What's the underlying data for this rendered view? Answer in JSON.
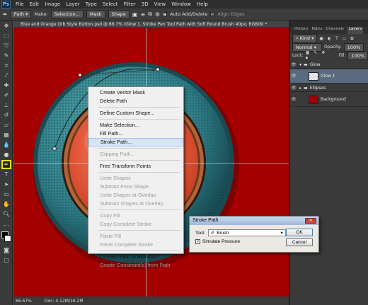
{
  "app": {
    "logo": "Ps"
  },
  "menubar": {
    "items": [
      "File",
      "Edit",
      "Image",
      "Layer",
      "Type",
      "Select",
      "Filter",
      "3D",
      "View",
      "Window",
      "Help"
    ]
  },
  "options": {
    "mode": "Path",
    "make_label": "Make:",
    "selection_btn": "Selection...",
    "mask_btn": "Mask",
    "shape_btn": "Shape",
    "auto_add_delete": "Auto Add/Delete",
    "align_edges": "Align Edges"
  },
  "document": {
    "tab_title": "Blue and Orange Orb Style Button.psd @ 66.7% (Glow 1, Stroke Pen Tool Path with Soft Round Brush 40px, RGB/8) *"
  },
  "status": {
    "zoom": "66.67%",
    "doc": "Doc: 4.12M/16.2M"
  },
  "context_menu": {
    "groups": [
      [
        {
          "label": "Create Vector Mask",
          "enabled": true
        },
        {
          "label": "Delete Path",
          "enabled": true
        }
      ],
      [
        {
          "label": "Define Custom Shape...",
          "enabled": true
        }
      ],
      [
        {
          "label": "Make Selection...",
          "enabled": true
        },
        {
          "label": "Fill Path...",
          "enabled": true
        },
        {
          "label": "Stroke Path...",
          "enabled": true,
          "highlighted": true
        }
      ],
      [
        {
          "label": "Clipping Path...",
          "enabled": false
        }
      ],
      [
        {
          "label": "Free Transform Points",
          "enabled": true
        }
      ],
      [
        {
          "label": "Unite Shapes",
          "enabled": false
        },
        {
          "label": "Subtract Front Shape",
          "enabled": false
        },
        {
          "label": "Unite Shapes at Overlap",
          "enabled": false
        },
        {
          "label": "Subtract Shapes at Overlap",
          "enabled": false
        }
      ],
      [
        {
          "label": "Copy Fill",
          "enabled": false
        },
        {
          "label": "Copy Complete Stroke",
          "enabled": false
        }
      ],
      [
        {
          "label": "Paste Fill",
          "enabled": false
        },
        {
          "label": "Paste Complete Stroke",
          "enabled": false
        }
      ],
      [
        {
          "label": "Convert Path to Extrusion",
          "enabled": true
        },
        {
          "label": "Create Constraint(s) from Path",
          "enabled": false
        }
      ]
    ]
  },
  "dialog": {
    "title": "Stroke Path",
    "tool_label": "Tool:",
    "tool_value": "Brush",
    "simulate_pressure": "Simulate Pressure",
    "ok": "OK",
    "cancel": "Cancel"
  },
  "panels": {
    "tabs": [
      "History",
      "Paths",
      "Channels",
      "Layers"
    ],
    "active_tab": "Layers",
    "kind_label": "Kind",
    "blend_mode": "Normal",
    "opacity_label": "Opacity:",
    "opacity_value": "100%",
    "lock_label": "Lock:",
    "fill_label": "Fill:",
    "fill_value": "100%",
    "layers": [
      {
        "name": "Glow",
        "type": "group"
      },
      {
        "name": "Glow 1",
        "type": "layer",
        "selected": true
      },
      {
        "name": "Ellipses",
        "type": "group"
      },
      {
        "name": "Background",
        "type": "layer"
      }
    ]
  },
  "colors": {
    "canvas_red": "#a40000",
    "orb_teal": "#2f7f8a",
    "orb_orange": "#e85a3c",
    "menu_highlight": "#d7e4f5",
    "tool_highlight": "#f6e800"
  }
}
